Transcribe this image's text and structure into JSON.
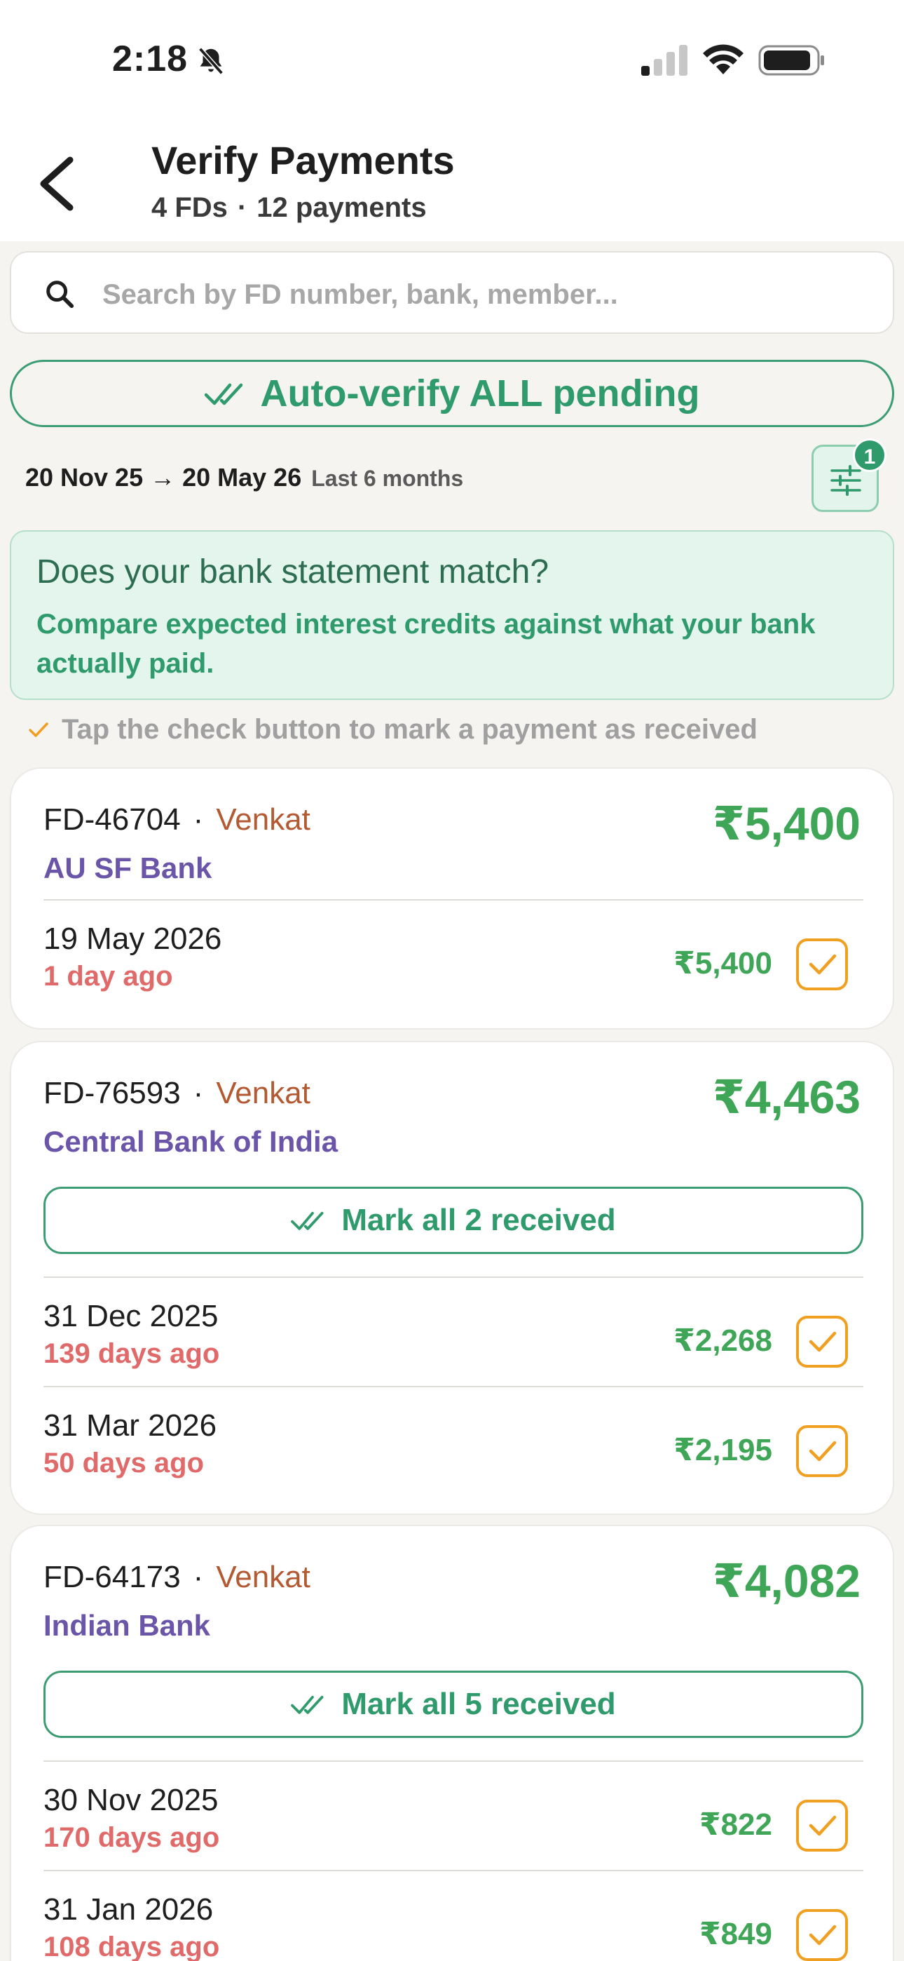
{
  "status": {
    "time": "2:18"
  },
  "header": {
    "title": "Verify Payments",
    "fd_count": "4 FDs",
    "separator": "·",
    "payment_count": "12 payments"
  },
  "search": {
    "placeholder": "Search by FD number, bank, member..."
  },
  "auto_verify": {
    "label": "Auto-verify ALL pending"
  },
  "range": {
    "dates": "20 Nov 25 → 20 May 26",
    "label": "Last 6 months"
  },
  "filter": {
    "badge": "1"
  },
  "info": {
    "heading": "Does your bank statement match?",
    "body": "Compare expected interest credits against what your bank actually paid."
  },
  "hint": {
    "text": "Tap the check button to mark a payment as received"
  },
  "colors": {
    "accent": "#2f9a6c",
    "amount": "#3fa657",
    "member": "#b35a33",
    "bank": "#6a55a8",
    "overdue": "#e06a6a",
    "check": "#f0a020"
  },
  "fds": [
    {
      "fd_number": "FD-46704",
      "member": "Venkat",
      "bank": "AU SF Bank",
      "total": "₹5,400",
      "mark_all": "",
      "payments": [
        {
          "date": "19 May 2026",
          "ago": "1 day ago",
          "amount": "₹5,400"
        }
      ]
    },
    {
      "fd_number": "FD-76593",
      "member": "Venkat",
      "bank": "Central Bank of India",
      "total": "₹4,463",
      "mark_all": "Mark all 2 received",
      "payments": [
        {
          "date": "31 Dec 2025",
          "ago": "139 days ago",
          "amount": "₹2,268"
        },
        {
          "date": "31 Mar 2026",
          "ago": "50 days ago",
          "amount": "₹2,195"
        }
      ]
    },
    {
      "fd_number": "FD-64173",
      "member": "Venkat",
      "bank": "Indian Bank",
      "total": "₹4,082",
      "mark_all": "Mark all 5 received",
      "payments": [
        {
          "date": "30 Nov 2025",
          "ago": "170 days ago",
          "amount": "₹822"
        },
        {
          "date": "31 Jan 2026",
          "ago": "108 days ago",
          "amount": "₹849"
        }
      ]
    }
  ]
}
